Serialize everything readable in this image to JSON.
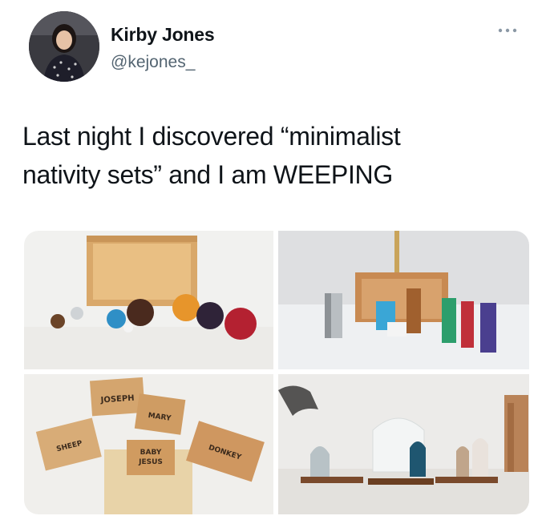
{
  "user": {
    "display_name": "Kirby Jones",
    "handle": "@kejones_"
  },
  "tweet": {
    "text_line1": "Last night I discovered “minimalist",
    "text_line2": "nativity sets” and I am WEEPING"
  },
  "photos": {
    "photo3_labels": {
      "joseph": "JOSEPH",
      "mary": "MARY",
      "sheep": "SHEEP",
      "baby": "BABY",
      "jesus": "JESUS",
      "donkey": "DONKEY"
    }
  },
  "icons": {
    "more": "more-options-icon"
  }
}
